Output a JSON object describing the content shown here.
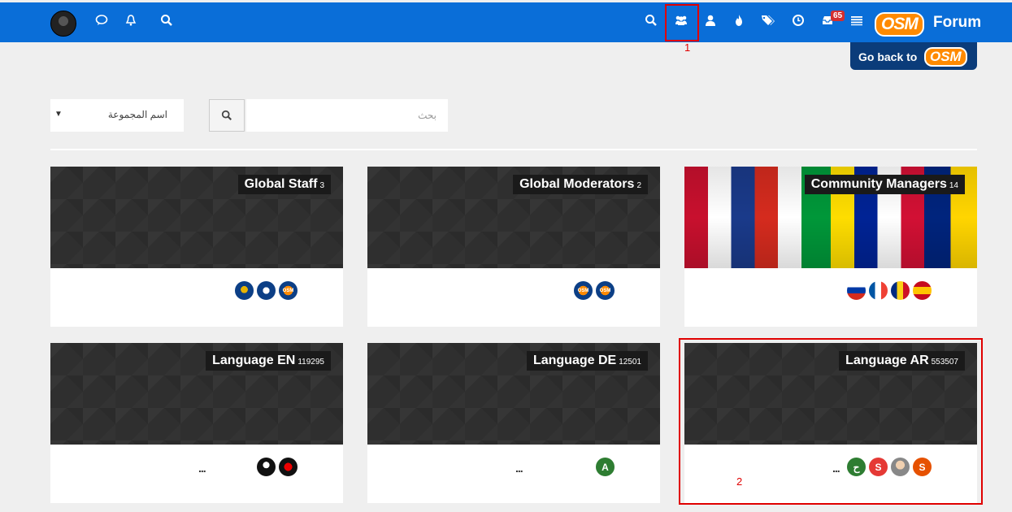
{
  "topbar": {
    "color": "#0a6ed8",
    "left_icons": [
      "avatar-icon",
      "chat-icon",
      "bell-icon",
      "search-icon"
    ],
    "right_icons": [
      "search-icon",
      "groups-icon",
      "user-icon",
      "fire-icon",
      "tags-icon",
      "clock-icon",
      "inbox-icon",
      "list-icon"
    ],
    "inbox_badge": "65",
    "logo_text": "OSM",
    "forum_label": "Forum"
  },
  "go_back": {
    "label": "Go back to",
    "logo": "OSM"
  },
  "annotations": {
    "box1_label": "1",
    "box2_label": "2",
    "color": "#e00000"
  },
  "filters": {
    "sort_select_value": "اسم المجموعة",
    "search_placeholder": "بحث"
  },
  "groups": [
    {
      "name": "Global Staff",
      "count": "3",
      "banner": "pattern",
      "members": [
        {
          "type": "img-osm",
          "label": "OSM"
        },
        {
          "type": "img-ball",
          "label": ""
        },
        {
          "type": "img-cup",
          "label": ""
        }
      ],
      "more": ""
    },
    {
      "name": "Global Moderators",
      "count": "2",
      "banner": "pattern",
      "members": [
        {
          "type": "img-osm",
          "label": "OSM"
        },
        {
          "type": "img-osm",
          "label": "OSM"
        }
      ],
      "more": ""
    },
    {
      "name": "Community Managers",
      "count": "14",
      "banner": "flags",
      "members": [
        {
          "type": "img-es",
          "label": ""
        },
        {
          "type": "img-ro",
          "label": ""
        },
        {
          "type": "img-fr",
          "label": ""
        },
        {
          "type": "img-ru",
          "label": ""
        }
      ],
      "more": ""
    },
    {
      "name": "Language EN",
      "count": "119295",
      "banner": "pattern",
      "members": [
        {
          "type": "img-red",
          "label": ""
        },
        {
          "type": "img-bw",
          "label": ""
        }
      ],
      "more": "..."
    },
    {
      "name": "Language DE",
      "count": "12501",
      "banner": "pattern",
      "members": [
        {
          "type": "letter",
          "label": "A",
          "color": "#2e7d32"
        }
      ],
      "more": "..."
    },
    {
      "name": "Language AR",
      "count": "553507",
      "banner": "pattern",
      "members": [
        {
          "type": "letter",
          "label": "S",
          "color": "#e65100"
        },
        {
          "type": "img-face",
          "label": ""
        },
        {
          "type": "letter",
          "label": "S",
          "color": "#e53935"
        },
        {
          "type": "letter",
          "label": "ح",
          "color": "#2e7d32"
        }
      ],
      "more": "..."
    }
  ]
}
